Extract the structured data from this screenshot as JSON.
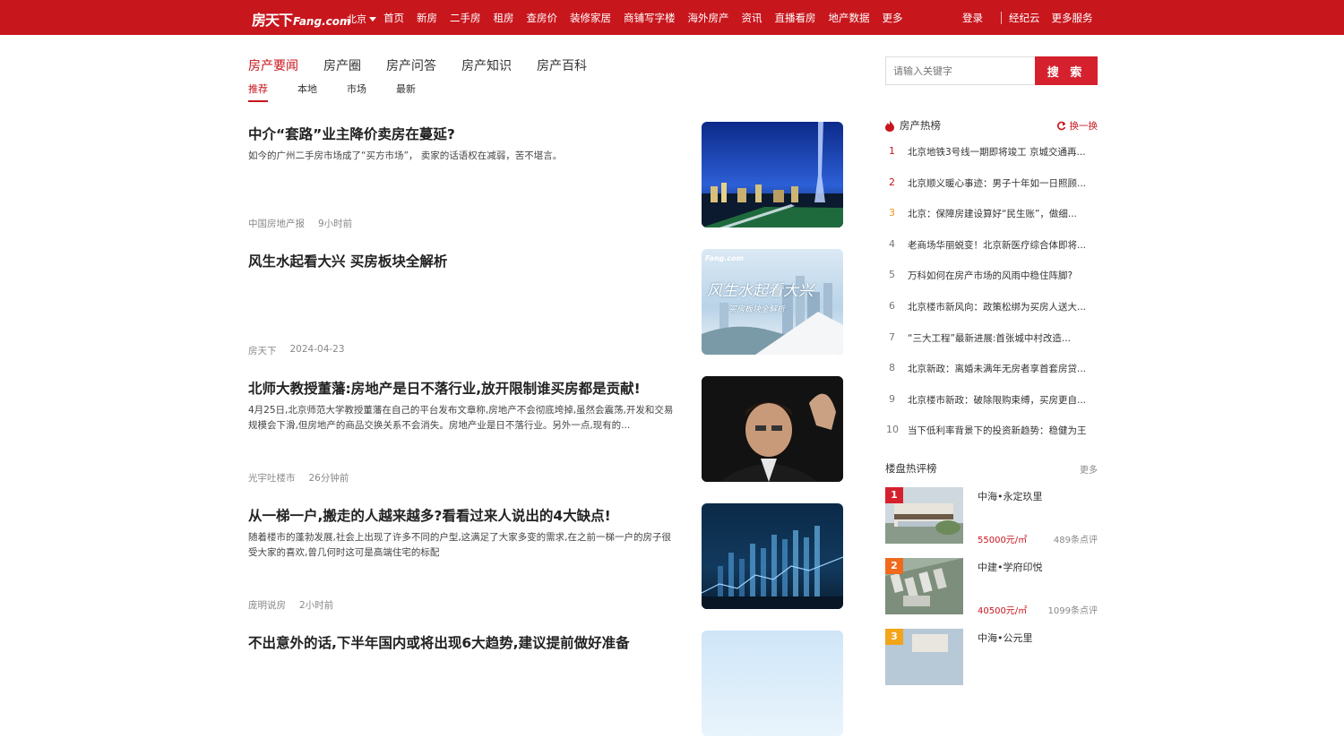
{
  "header": {
    "logo_cn": "房天下",
    "logo_en": "Fang.com",
    "city": "北京",
    "nav": [
      "首页",
      "新房",
      "二手房",
      "租房",
      "查房价",
      "装修家居",
      "商铺写字楼",
      "海外房产",
      "资讯",
      "直播看房",
      "地产数据",
      "更多"
    ],
    "login": "登录",
    "agent": "经纪云",
    "more_services": "更多服务"
  },
  "category_tabs": [
    "房产要闻",
    "房产圈",
    "房产问答",
    "房产知识",
    "房产百科"
  ],
  "sub_tabs": [
    "推荐",
    "本地",
    "市场",
    "最新"
  ],
  "articles": [
    {
      "title": "中介“套路”业主降价卖房在蔓延?",
      "summary": "如今的广州二手房市场成了“买方市场”， 卖家的话语权在减弱，苦不堪言。",
      "source": "中国房地产报",
      "time": "9小时前"
    },
    {
      "title": "风生水起看大兴 买房板块全解析",
      "summary": "",
      "source": "房天下",
      "time": "2024-04-23",
      "thumb_logo": "Fang.com",
      "thumb_title": "风生水起看大兴",
      "thumb_subtitle": "买房板块全解析"
    },
    {
      "title": "北师大教授董藩:房地产是日不落行业,放开限制谁买房都是贡献!",
      "summary": "4月25日,北京师范大学教授董藩在自己的平台发布文章称,房地产不会彻底垮掉,虽然会震荡,开发和交易规模会下滑,但房地产的商品交换关系不会消失。房地产业是日不落行业。另外一点,现有的...",
      "source": "光宇吐楼市",
      "time": "26分钟前"
    },
    {
      "title": "从一梯一户,搬走的人越来越多?看看过来人说出的4大缺点!",
      "summary": "随着楼市的蓬勃发展,社会上出现了许多不同的户型,这满足了大家多变的需求,在之前一梯一户的房子很受大家的喜欢,曾几何时这可是高端住宅的标配",
      "source": "庞明说房",
      "time": "2小时前"
    },
    {
      "title": "不出意外的话,下半年国内或将出现6大趋势,建议提前做好准备",
      "summary": "",
      "source": "",
      "time": ""
    }
  ],
  "search": {
    "placeholder": "请输入关键字",
    "button": "搜 索"
  },
  "hot_list": {
    "title": "房产热榜",
    "swap": "换一换",
    "items": [
      {
        "num": "1",
        "text": "北京地铁3号线一期即将竣工 京城交通再..."
      },
      {
        "num": "2",
        "text": "北京顺义暖心事迹：男子十年如一日照顾..."
      },
      {
        "num": "3",
        "text": "北京：保障房建设算好“民生账”，做细..."
      },
      {
        "num": "4",
        "text": "老商场华丽蜕变！北京新医疗综合体即将..."
      },
      {
        "num": "5",
        "text": "万科如何在房产市场的风雨中稳住阵脚?"
      },
      {
        "num": "6",
        "text": "北京楼市新风向：政策松绑为买房人送大..."
      },
      {
        "num": "7",
        "text": "“三大工程”最新进展:首张城中村改造..."
      },
      {
        "num": "8",
        "text": "北京新政：离婚未满年无房者享首套房贷..."
      },
      {
        "num": "9",
        "text": "北京楼市新政：破除限购束缚，买房更自..."
      },
      {
        "num": "10",
        "text": "当下低利率背景下的投资新趋势：稳健为王"
      }
    ]
  },
  "eval_list": {
    "title": "楼盘热评榜",
    "more": "更多",
    "items": [
      {
        "rank": "1",
        "name": "中海•永定玖里",
        "price": "55000元/㎡",
        "reviews": "489条点评",
        "rank_color": "#d5212e"
      },
      {
        "rank": "2",
        "name": "中建•学府印悦",
        "price": "40500元/㎡",
        "reviews": "1099条点评",
        "rank_color": "#f06a1d"
      },
      {
        "rank": "3",
        "name": "中海•公元里",
        "price": "",
        "reviews": "",
        "rank_color": "#f2a51a"
      }
    ]
  },
  "colors": {
    "brand_red": "#c8161d",
    "search_red": "#d5212e"
  }
}
